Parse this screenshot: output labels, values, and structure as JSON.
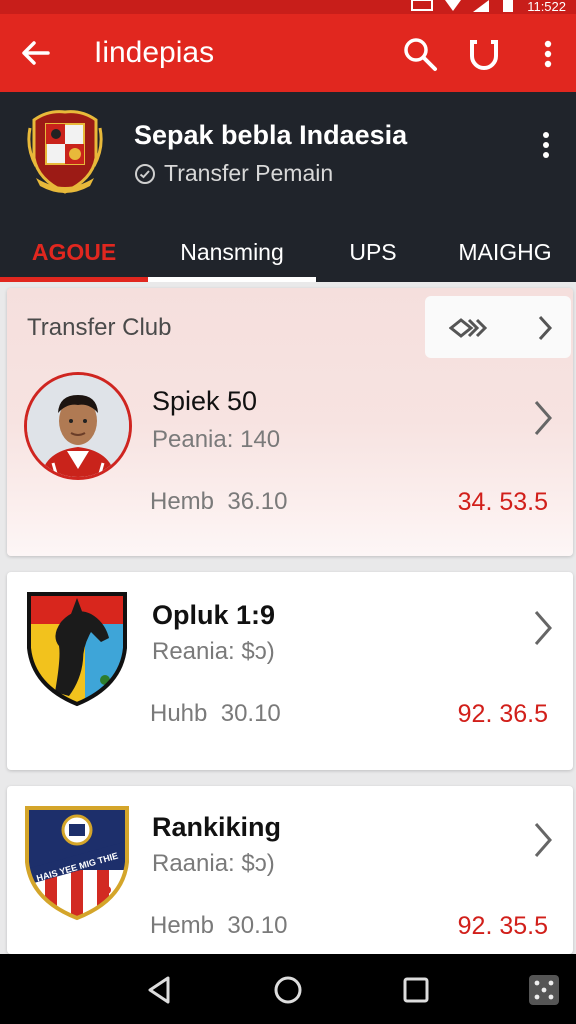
{
  "status_bar": {
    "time": "11:522"
  },
  "app_bar": {
    "title": "Iindepias",
    "icons": [
      "back-arrow-icon",
      "search-icon",
      "magnet-icon",
      "more-vert-icon"
    ]
  },
  "club_header": {
    "name": "Sepak bebla Indaesia",
    "subtitle": "Transfer Pemain",
    "tabs": [
      {
        "label": "AGOUE",
        "active": true
      },
      {
        "label": "Nansming",
        "active": false
      },
      {
        "label": "UPS",
        "active": false
      },
      {
        "label": "MAIGHG",
        "active": false
      }
    ]
  },
  "cards": [
    {
      "heading": "Transfer Club",
      "name": "Spiek 50",
      "line": "Peania: 140",
      "label": "Hemb",
      "label_value": "36.10",
      "price": "34. 53.5"
    },
    {
      "name": "Opluk 1:9",
      "line": "Reania: $ɔ)",
      "label": "Huhb",
      "label_value": "30.10",
      "price": "92. 36.5"
    },
    {
      "name": "Rankiking",
      "line": "Raania: $ɔ)",
      "label": "Hemb",
      "label_value": "30.10",
      "price": "92. 35.5",
      "badge_text": "HAIS YEE MIG THIE"
    }
  ],
  "colors": {
    "app_bar": "#e1271f",
    "status_bar": "#c81e1a",
    "header_bg": "#20242b",
    "price_red": "#d11f1a",
    "active_tab": "#e1271f"
  },
  "nav_bar": {
    "icons": [
      "nav-back-icon",
      "nav-home-icon",
      "nav-recents-icon",
      "nav-dice-icon"
    ]
  }
}
